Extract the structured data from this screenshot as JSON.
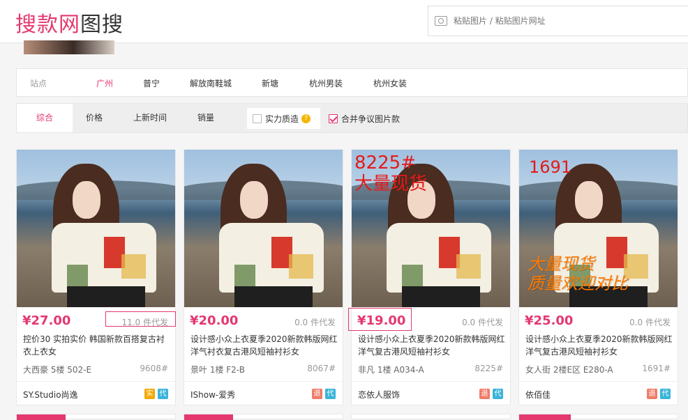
{
  "logo": {
    "part1": "搜款网",
    "part2": "图搜"
  },
  "search": {
    "placeholder": "粘贴图片 / 粘贴图片网址"
  },
  "sites": {
    "label": "站点",
    "items": [
      "广州",
      "普宁",
      "解放南鞋城",
      "新塘",
      "杭州男装",
      "杭州女装"
    ],
    "active": "广州"
  },
  "sort": {
    "tabs": [
      "综合",
      "价格",
      "上新时间",
      "销量"
    ],
    "active": "综合",
    "filter1": "实力质造",
    "filter2": "合并争议图片款"
  },
  "products": [
    {
      "price": "¥27.00",
      "sold": "11.0 件代发",
      "title": "控价30 实拍实价 韩国新款百搭复古衬衣上衣女",
      "location": "大西豪 5楼 502-E",
      "code": "9608#",
      "shop": "SY.Studio尚逸",
      "badges": [
        "实",
        "代"
      ],
      "overlay_top": "",
      "overlay_mid": ""
    },
    {
      "price": "¥20.00",
      "sold": "0.0 件代发",
      "title": "设计感小众上衣夏季2020新款韩版网红洋气衬衣复古港风短袖衬衫女",
      "location": "景叶 1楼 F2-B",
      "code": "8067#",
      "shop": "IShow-爱秀",
      "badges": [
        "退",
        "代"
      ],
      "overlay_top": "",
      "overlay_mid": ""
    },
    {
      "price": "¥19.00",
      "sold": "0.0 件代发",
      "title": "设计感小众上衣夏季2020新款韩版网红洋气复古港风短袖衬衫女",
      "location": "非凡 1楼 A034-A",
      "code": "8225#",
      "shop": "恋依人服饰",
      "badges": [
        "退",
        "代"
      ],
      "overlay_top": "8225#\n大量现货",
      "overlay_mid": ""
    },
    {
      "price": "¥25.00",
      "sold": "0.0 件代发",
      "title": "设计感小众上衣夏季2020新款韩版网红洋气复古港风短袖衬衫女",
      "location": "女人街 2楼E区 E280-A",
      "code": "1691#",
      "shop": "依佰佳",
      "badges": [
        "退",
        "代"
      ],
      "overlay_top": "1691",
      "overlay_mid": "大量现货\n质量欢迎对比"
    }
  ],
  "colors": {
    "accent": "#e4386f",
    "badge_shi": "#f2a900",
    "badge_dai": "#3bb4d8",
    "badge_tui": "#f07c6a"
  }
}
